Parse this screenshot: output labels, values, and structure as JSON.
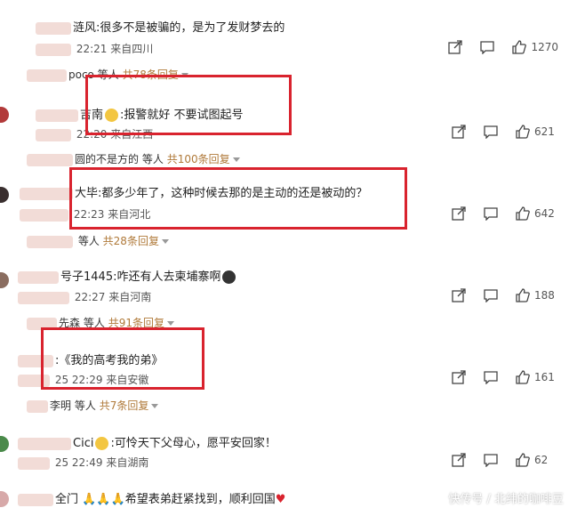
{
  "comments": [
    {
      "user": "涟风",
      "text": ":很多不是被骗的，是为了发财梦去的",
      "time": "22:21",
      "location": "来自四川",
      "likes": "1270",
      "replies_prefix": "poco",
      "replies_who": "等人",
      "replies_count": "共78条回复"
    },
    {
      "user": "吉南",
      "text": ":报警就好  不要试图起号",
      "time": "22:20",
      "location": "来自江西",
      "likes": "621",
      "replies_prefix": "圆的不是方的",
      "replies_who": "等人",
      "replies_count": "共100条回复"
    },
    {
      "user": "大毕",
      "text": ":都多少年了，这种时候去那的是主动的还是被动的？",
      "time": "22:23",
      "location": "来自河北",
      "likes": "642",
      "replies_prefix": "",
      "replies_who": "等人",
      "replies_count": "共28条回复"
    },
    {
      "user": "号子1445",
      "text": ":咋还有人去柬埔寨啊",
      "time": "22:27",
      "location": "来自河南",
      "likes": "188",
      "replies_prefix": "先森",
      "replies_who": "等人",
      "replies_count": "共91条回复"
    },
    {
      "user": "",
      "text": ":《我的高考我的弟》",
      "time": "25 22:29",
      "location": "来自安徽",
      "likes": "161",
      "replies_prefix": "李明",
      "replies_who": "等人",
      "replies_count": "共7条回复"
    },
    {
      "user": "Cici",
      "text": ":可怜天下父母心，愿平安回家！",
      "time": "25 22:49",
      "location": "来自湖南",
      "likes": "62",
      "replies_prefix": "",
      "replies_who": "",
      "replies_count": ""
    },
    {
      "user": "全门",
      "text": "希望表弟赶紧找到，顺利回国",
      "time": "",
      "location": "",
      "likes": "",
      "replies_prefix": "",
      "replies_who": "",
      "replies_count": ""
    }
  ],
  "watermark": "快传号 / 北纬的咖啡豆",
  "colors": {
    "highlight_box": "#d9232e",
    "reply_link": "#b07a3a"
  }
}
